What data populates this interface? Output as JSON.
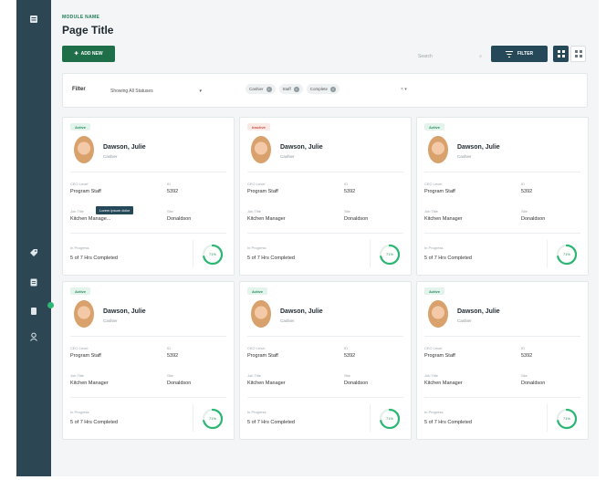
{
  "rail": {
    "icons": [
      "menu-icon",
      "tag-icon",
      "clipboard-icon",
      "document-icon",
      "user-icon"
    ]
  },
  "header": {
    "module_name": "MODULE NAME",
    "page_title": "Page Title"
  },
  "toolbar": {
    "add_label": "ADD NEW",
    "search_placeholder": "Search",
    "filter_label": "FILTER"
  },
  "filter_bar": {
    "label": "Filter",
    "select_value": "Showing All Statuses",
    "chips": [
      "Cashier",
      "Staff",
      "Complete"
    ]
  },
  "cards": [
    {
      "status": "Active",
      "status_type": "active",
      "name": "Dawson, Julie",
      "role": "Cashier",
      "fields": [
        {
          "label": "CEO Level",
          "value": "Program Staff"
        },
        {
          "label": "ID",
          "value": "5392"
        },
        {
          "label": "Job Title",
          "value": "Kitchen Manage..."
        },
        {
          "label": "Site",
          "value": "Donaldson"
        }
      ],
      "tooltip": "Lorem ipsum dolor",
      "progress_label": "In Progress",
      "progress_value": "5 of 7 Hrs Completed",
      "ring_text": "71%",
      "percent": 71
    },
    {
      "status": "Inactive",
      "status_type": "inactive",
      "name": "Dawson, Julie",
      "role": "Cashier",
      "fields": [
        {
          "label": "CEO Level",
          "value": "Program Staff"
        },
        {
          "label": "ID",
          "value": "5392"
        },
        {
          "label": "Job Title",
          "value": "Kitchen Manager"
        },
        {
          "label": "Site",
          "value": "Donaldson"
        }
      ],
      "progress_label": "In Progress",
      "progress_value": "5 of 7 Hrs Completed",
      "ring_text": "71%",
      "percent": 71
    },
    {
      "status": "Active",
      "status_type": "active",
      "name": "Dawson, Julie",
      "role": "Cashier",
      "fields": [
        {
          "label": "CEO Level",
          "value": "Program Staff"
        },
        {
          "label": "ID",
          "value": "5392"
        },
        {
          "label": "Job Title",
          "value": "Kitchen Manager"
        },
        {
          "label": "Site",
          "value": "Donaldson"
        }
      ],
      "progress_label": "In Progress",
      "progress_value": "5 of 7 Hrs Completed",
      "ring_text": "71%",
      "percent": 71
    },
    {
      "status": "Active",
      "status_type": "active",
      "name": "Dawson, Julie",
      "role": "Cashier",
      "fields": [
        {
          "label": "CEO Level",
          "value": "Program Staff"
        },
        {
          "label": "ID",
          "value": "5392"
        },
        {
          "label": "Job Title",
          "value": "Kitchen Manager"
        },
        {
          "label": "Site",
          "value": "Donaldson"
        }
      ],
      "progress_label": "In Progress",
      "progress_value": "5 of 7 Hrs Completed",
      "ring_text": "71%",
      "percent": 71
    },
    {
      "status": "Active",
      "status_type": "active",
      "name": "Dawson, Julie",
      "role": "Cashier",
      "fields": [
        {
          "label": "CEO Level",
          "value": "Program Staff"
        },
        {
          "label": "ID",
          "value": "5392"
        },
        {
          "label": "Job Title",
          "value": "Kitchen Manager"
        },
        {
          "label": "Site",
          "value": "Donaldson"
        }
      ],
      "progress_label": "In Progress",
      "progress_value": "5 of 7 Hrs Completed",
      "ring_text": "71%",
      "percent": 71
    },
    {
      "status": "Active",
      "status_type": "active",
      "name": "Dawson, Julie",
      "role": "Cashier",
      "fields": [
        {
          "label": "CEO Level",
          "value": "Program Staff"
        },
        {
          "label": "ID",
          "value": "5392"
        },
        {
          "label": "Job Title",
          "value": "Kitchen Manager"
        },
        {
          "label": "Site",
          "value": "Donaldson"
        }
      ],
      "progress_label": "In Progress",
      "progress_value": "5 of 7 Hrs Completed",
      "ring_text": "71%",
      "percent": 71
    }
  ],
  "colors": {
    "rail": "#2d4653",
    "primary": "#1f6e4a",
    "secondary": "#26495a",
    "accent": "#2bb673"
  }
}
